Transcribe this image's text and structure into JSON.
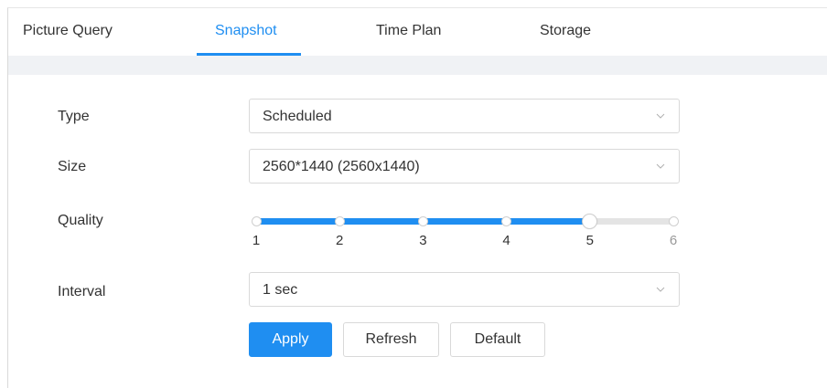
{
  "tabs": [
    {
      "label": "Picture Query",
      "active": false
    },
    {
      "label": "Snapshot",
      "active": true
    },
    {
      "label": "Time Plan",
      "active": false
    },
    {
      "label": "Storage",
      "active": false
    }
  ],
  "form": {
    "type": {
      "label": "Type",
      "value": "Scheduled"
    },
    "size": {
      "label": "Size",
      "value": "2560*1440 (2560x1440)"
    },
    "quality": {
      "label": "Quality",
      "ticks": [
        "1",
        "2",
        "3",
        "4",
        "5",
        "6"
      ],
      "value": 5,
      "min": 1,
      "max": 6
    },
    "interval": {
      "label": "Interval",
      "value": "1 sec"
    }
  },
  "buttons": {
    "apply": "Apply",
    "refresh": "Refresh",
    "default": "Default"
  },
  "colors": {
    "accent": "#1f8ef1",
    "band": "#f0f2f5",
    "track": "#e4e4e4"
  },
  "icons": {
    "dropdown": "chevron-down-icon"
  }
}
